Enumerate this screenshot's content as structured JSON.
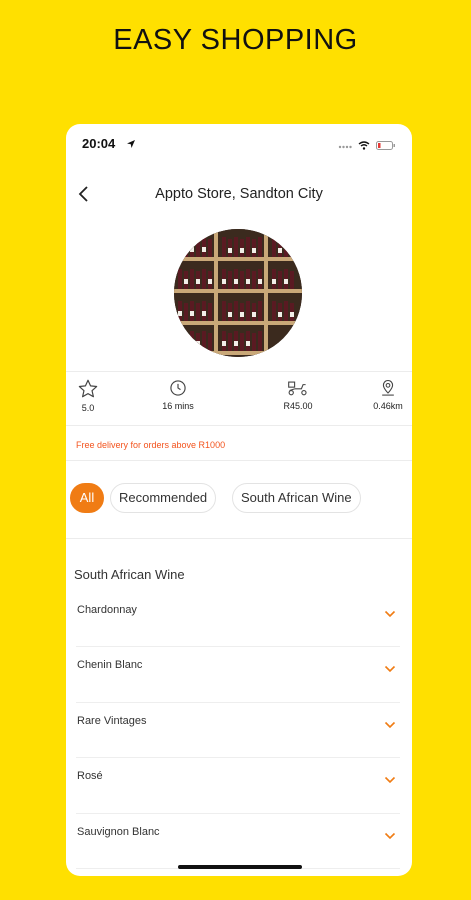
{
  "promo": {
    "title": "EASY SHOPPING"
  },
  "status_bar": {
    "time": "20:04"
  },
  "header": {
    "title": "Appto Store, Sandton City",
    "back_icon": "chevron-left-icon"
  },
  "stats": [
    {
      "icon": "star-icon",
      "value": "5.0"
    },
    {
      "icon": "clock-icon",
      "value": "16 mins"
    },
    {
      "icon": "delivery-scooter-icon",
      "value": "R45.00"
    },
    {
      "icon": "location-pin-icon",
      "value": "0.46km"
    }
  ],
  "free_delivery": "Free delivery for orders above R1000",
  "chips": [
    {
      "label": "All",
      "active": true
    },
    {
      "label": "Recommended",
      "active": false
    },
    {
      "label": "South African Wine",
      "active": false
    }
  ],
  "section_title": "South African Wine",
  "categories": [
    {
      "label": "Chardonnay"
    },
    {
      "label": "Chenin Blanc"
    },
    {
      "label": "Rare Vintages"
    },
    {
      "label": "Rosé"
    },
    {
      "label": "Sauvignon Blanc"
    }
  ],
  "colors": {
    "background": "#FFE000",
    "accent": "#F07C14",
    "promo_text": "#F3541E"
  }
}
